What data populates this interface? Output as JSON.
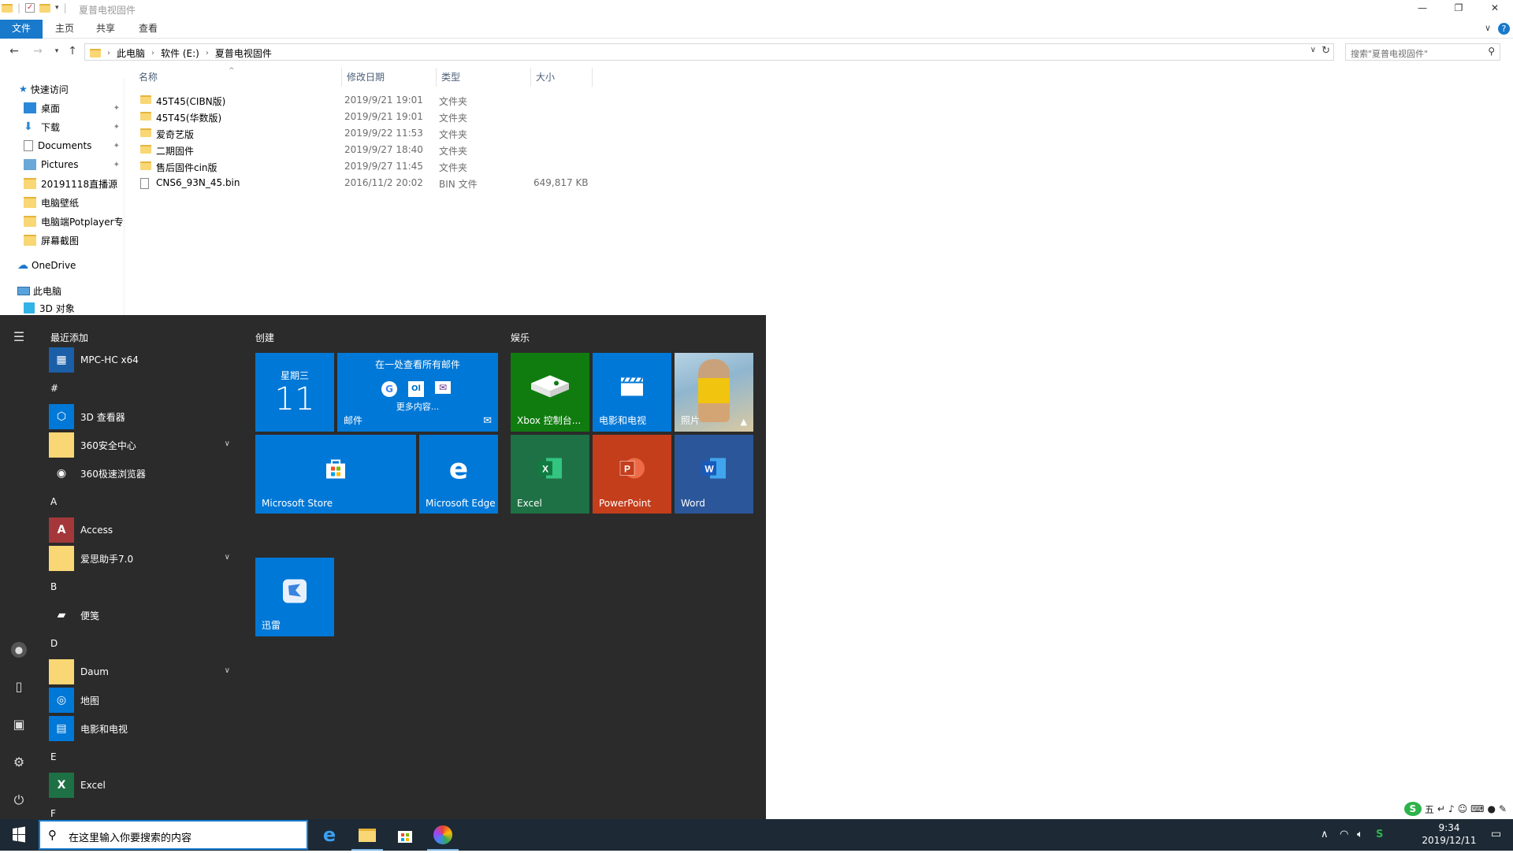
{
  "window": {
    "title": "夏普电视固件",
    "ribbon_tabs": [
      "文件",
      "主页",
      "共享",
      "查看"
    ]
  },
  "address": {
    "crumbs": [
      "此电脑",
      "软件 (E:)",
      "夏普电视固件"
    ],
    "search_placeholder": "搜索\"夏普电视固件\""
  },
  "nav": {
    "quick_access": "快速访问",
    "items": [
      {
        "label": "桌面",
        "pinned": true,
        "icon": "desktop-icon"
      },
      {
        "label": "下载",
        "pinned": true,
        "icon": "download-icon"
      },
      {
        "label": "Documents",
        "pinned": true,
        "icon": "document-icon"
      },
      {
        "label": "Pictures",
        "pinned": true,
        "icon": "pictures-icon"
      },
      {
        "label": "20191118直播源",
        "pinned": false,
        "icon": "folder-icon"
      },
      {
        "label": "电脑壁纸",
        "pinned": false,
        "icon": "folder-icon"
      },
      {
        "label": "电脑端Potplayer专",
        "pinned": false,
        "icon": "folder-icon"
      },
      {
        "label": "屏幕截图",
        "pinned": false,
        "icon": "folder-icon"
      }
    ],
    "onedrive": "OneDrive",
    "this_pc": "此电脑",
    "objects3d": "3D 对象"
  },
  "files": {
    "headers": [
      "名称",
      "修改日期",
      "类型",
      "大小"
    ],
    "rows": [
      {
        "name": "45T45(CIBN版)",
        "date": "2019/9/21 19:01",
        "type": "文件夹",
        "size": "",
        "icon": "folder-icon"
      },
      {
        "name": "45T45(华数版)",
        "date": "2019/9/21 19:01",
        "type": "文件夹",
        "size": "",
        "icon": "folder-icon"
      },
      {
        "name": "爱奇艺版",
        "date": "2019/9/22 11:53",
        "type": "文件夹",
        "size": "",
        "icon": "folder-icon"
      },
      {
        "name": "二期固件",
        "date": "2019/9/27 18:40",
        "type": "文件夹",
        "size": "",
        "icon": "folder-icon"
      },
      {
        "name": "售后固件cin版",
        "date": "2019/9/27 11:45",
        "type": "文件夹",
        "size": "",
        "icon": "folder-icon"
      },
      {
        "name": "CNS6_93N_45.bin",
        "date": "2016/11/2 20:02",
        "type": "BIN 文件",
        "size": "649,817 KB",
        "icon": "file-icon"
      }
    ]
  },
  "start": {
    "recent_header": "最近添加",
    "apps": [
      {
        "kind": "app",
        "label": "MPC-HC x64",
        "icon": "mpc-icon",
        "color": "#1b5fa8",
        "glyph": "▦"
      },
      {
        "kind": "hdr",
        "label": "#"
      },
      {
        "kind": "app",
        "label": "3D 查看器",
        "icon": "3d-viewer-icon",
        "color": "#0078d7",
        "glyph": "⬡"
      },
      {
        "kind": "app",
        "label": "360安全中心",
        "icon": "folder-icon",
        "color": "#f8d774",
        "glyph": "",
        "expand": true
      },
      {
        "kind": "app",
        "label": "360极速浏览器",
        "icon": "360-browser-icon",
        "color": "#2b2b2b",
        "glyph": "◉"
      },
      {
        "kind": "hdr",
        "label": "A"
      },
      {
        "kind": "app",
        "label": "Access",
        "icon": "access-icon",
        "color": "#a4373a",
        "glyph": "A"
      },
      {
        "kind": "app",
        "label": "爱思助手7.0",
        "icon": "folder-icon",
        "color": "#f8d774",
        "glyph": "",
        "expand": true
      },
      {
        "kind": "hdr",
        "label": "B"
      },
      {
        "kind": "app",
        "label": "便笺",
        "icon": "sticky-notes-icon",
        "color": "#2b2b2b",
        "glyph": "▰"
      },
      {
        "kind": "hdr",
        "label": "D"
      },
      {
        "kind": "app",
        "label": "Daum",
        "icon": "folder-icon",
        "color": "#f8d774",
        "glyph": "",
        "expand": true
      },
      {
        "kind": "app",
        "label": "地图",
        "icon": "maps-icon",
        "color": "#0078d7",
        "glyph": "◎"
      },
      {
        "kind": "app",
        "label": "电影和电视",
        "icon": "movies-icon",
        "color": "#0078d7",
        "glyph": "▤"
      },
      {
        "kind": "hdr",
        "label": "E"
      },
      {
        "kind": "app",
        "label": "Excel",
        "icon": "excel-icon",
        "color": "#1e7145",
        "glyph": "X"
      },
      {
        "kind": "hdr",
        "label": "F"
      }
    ],
    "groups": {
      "create": "创建",
      "entertain": "娱乐"
    },
    "tiles": {
      "calendar_day": "星期三",
      "calendar_date": "11",
      "mail_header": "在一处查看所有邮件",
      "mail_more": "更多内容...",
      "mail_label": "邮件",
      "store": "Microsoft Store",
      "edge": "Microsoft Edge",
      "xbox": "Xbox 控制台...",
      "movies": "电影和电视",
      "photos": "照片",
      "excel": "Excel",
      "powerpoint": "PowerPoint",
      "word": "Word",
      "xunlei": "迅雷"
    }
  },
  "taskbar": {
    "search_placeholder": "在这里输入你要搜索的内容",
    "time": "9:34",
    "date": "2019/12/11"
  },
  "colors": {
    "accent": "#1979ca",
    "tile_blue": "#0078d7",
    "xbox_green": "#107c10",
    "excel_green": "#1e7145",
    "ppt_red": "#c43e1c",
    "word_blue": "#2b579a"
  }
}
